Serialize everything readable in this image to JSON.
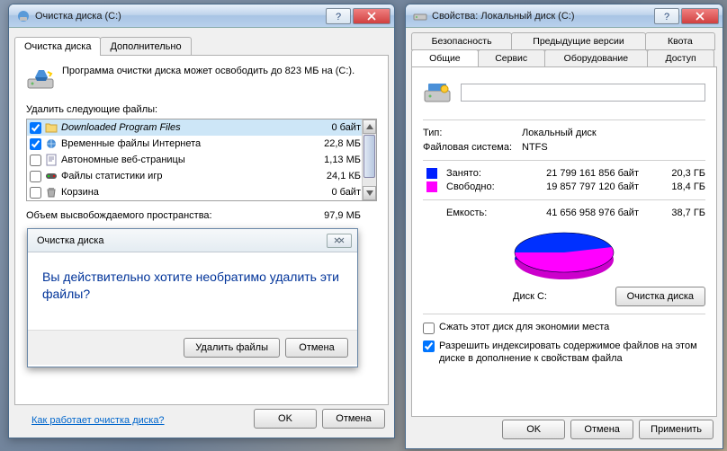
{
  "cleanup": {
    "title": "Очистка диска  (C:)",
    "tabs": {
      "main": "Очистка диска",
      "extra": "Дополнительно"
    },
    "desc": "Программа очистки диска может освободить до 823 МБ на  (C:).",
    "list_label": "Удалить следующие файлы:",
    "items": [
      {
        "checked": true,
        "name": "Downloaded Program Files",
        "size": "0 байт"
      },
      {
        "checked": true,
        "name": "Временные файлы Интернета",
        "size": "22,8 МБ"
      },
      {
        "checked": false,
        "name": "Автономные веб-страницы",
        "size": "1,13 МБ"
      },
      {
        "checked": false,
        "name": "Файлы статистики игр",
        "size": "24,1 КБ"
      },
      {
        "checked": false,
        "name": "Корзина",
        "size": "0 байт"
      }
    ],
    "total_label": "Объем высвобождаемого пространства:",
    "total_value": "97,9 МБ",
    "help_link": "Как работает очистка диска?",
    "ok": "OK",
    "cancel": "Отмена"
  },
  "confirm": {
    "title": "Очистка диска",
    "message": "Вы действительно хотите необратимо удалить эти файлы?",
    "delete": "Удалить файлы",
    "cancel": "Отмена"
  },
  "props": {
    "title": "Свойства: Локальный диск (C:)",
    "tabs_top": [
      "Безопасность",
      "Предыдущие версии",
      "Квота"
    ],
    "tabs_bottom": [
      "Общие",
      "Сервис",
      "Оборудование",
      "Доступ"
    ],
    "volume_label": "",
    "type_label": "Тип:",
    "type_value": "Локальный диск",
    "fs_label": "Файловая система:",
    "fs_value": "NTFS",
    "used": {
      "label": "Занято:",
      "bytes": "21 799 161 856 байт",
      "gb": "20,3 ГБ",
      "color": "#0020ff"
    },
    "free": {
      "label": "Свободно:",
      "bytes": "19 857 797 120 байт",
      "gb": "18,4 ГБ",
      "color": "#ff00ff"
    },
    "total": {
      "label": "Емкость:",
      "bytes": "41 656 958 976 байт",
      "gb": "38,7 ГБ"
    },
    "disk_label": "Диск C:",
    "cleanup_btn": "Очистка диска",
    "chk_compress": "Сжать этот диск для экономии места",
    "chk_index": "Разрешить индексировать содержимое файлов на этом диске в дополнение к свойствам файла",
    "ok": "OK",
    "cancel": "Отмена",
    "apply": "Применить"
  }
}
